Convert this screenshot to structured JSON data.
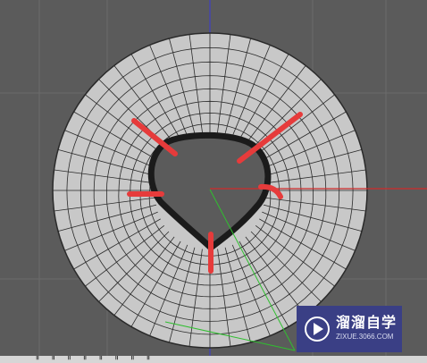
{
  "viewport": {
    "background": "#5b5b5b",
    "grid_color": "#6b6b6b",
    "mesh_fill": "#c8c8c8",
    "mesh_line": "#2a2a2a",
    "axis_vertical_color": "#3b3bd6",
    "axis_horizontal_color": "#cf2b2b",
    "axis_green_color": "#2fbf2f",
    "highlight_color": "#e63b3b",
    "rings": 9,
    "spokes": 48
  },
  "watermark": {
    "brand": "溜溜自学",
    "url": "ZIXUE.3066.COM",
    "icon": "play-icon",
    "background": "#3a3f85"
  },
  "bottom_strip": {
    "text": "·· ‖ ·· ‖ ·· ‖ ·· ‖ ·· ‖ ·· ‖ ·· ‖ ·· ‖"
  }
}
